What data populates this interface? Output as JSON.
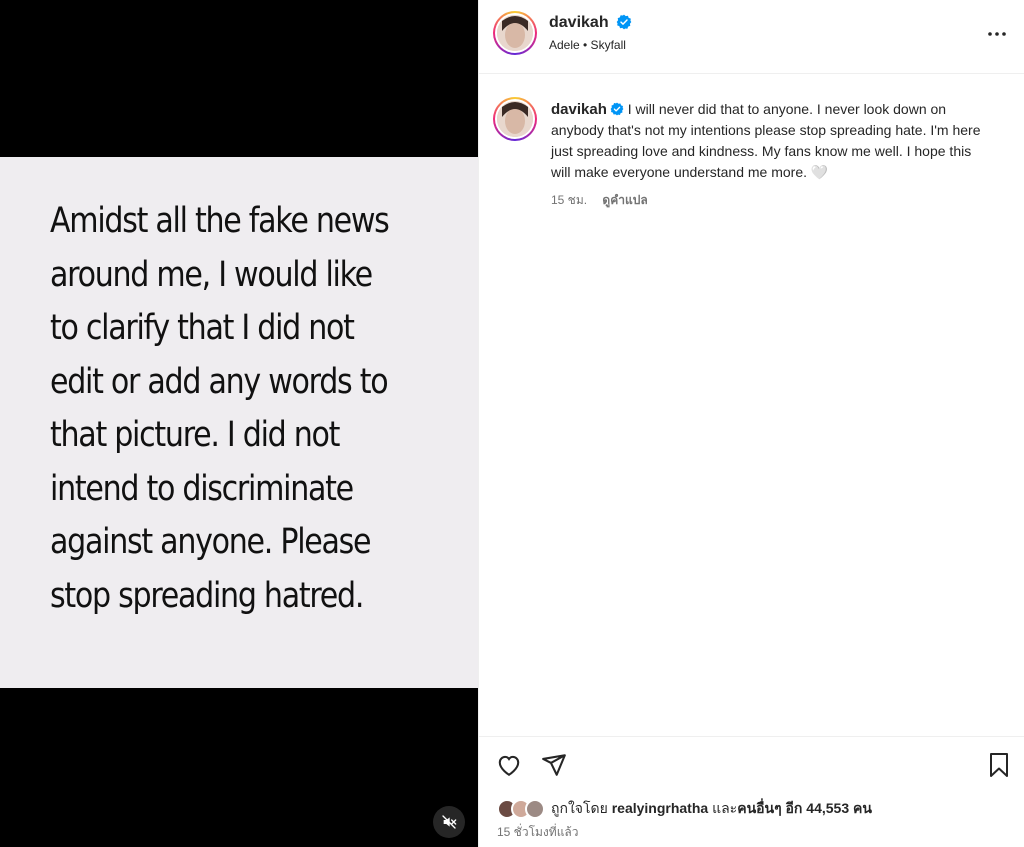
{
  "colors": {
    "verified": "#0095f6",
    "muted_text": "#737373",
    "text": "#262626"
  },
  "media": {
    "text": "Amidst all the fake news\naround me, I would like\nto clarify that I did not\nedit or add any words to\nthat picture. I did not\nintend to discriminate\nagainst anyone. Please\nstop spreading hatred.",
    "mute_icon": "speaker-muted-icon"
  },
  "header": {
    "username": "davikah",
    "audio": "Adele • Skyfall",
    "more_icon": "more-horizontal-icon"
  },
  "caption": {
    "username": "davikah",
    "text": "I will never did that to anyone. I never look down on anybody that's not my intentions please stop spreading hate. I'm here just spreading love and kindness. My fans know me well. I hope this will make everyone understand me more. 🤍",
    "time": "15 ชม.",
    "translate": "ดูคำแปล"
  },
  "actions": {
    "icons": [
      "heart-icon",
      "share-icon",
      "bookmark-icon"
    ],
    "liked_prefix": "ถูกใจโดย",
    "liked_user": "realyingrhatha",
    "liked_suffix_pre": "และ",
    "liked_others": "คนอื่นๆ อีก 44,553 คน",
    "time_ago": "15 ชั่วโมงที่แล้ว"
  }
}
